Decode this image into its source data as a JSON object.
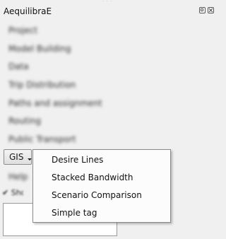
{
  "panel": {
    "title": "AequilibraE"
  },
  "blurred_menu": [
    {
      "label": "Project"
    },
    {
      "label": "Model Building"
    },
    {
      "label": "Data"
    },
    {
      "label": "Trip Distribution"
    },
    {
      "label": "Paths and assignment"
    },
    {
      "label": "Routing"
    },
    {
      "label": "Public Transport"
    }
  ],
  "gis_button": {
    "label": "GIS"
  },
  "blurred_below": [
    {
      "label": "Help"
    }
  ],
  "blurred_checkbox": {
    "label": "✔ Show"
  },
  "dropdown": {
    "items": [
      {
        "label": "Desire Lines"
      },
      {
        "label": "Stacked Bandwidth"
      },
      {
        "label": "Scenario Comparison"
      },
      {
        "label": "Simple tag"
      }
    ]
  }
}
